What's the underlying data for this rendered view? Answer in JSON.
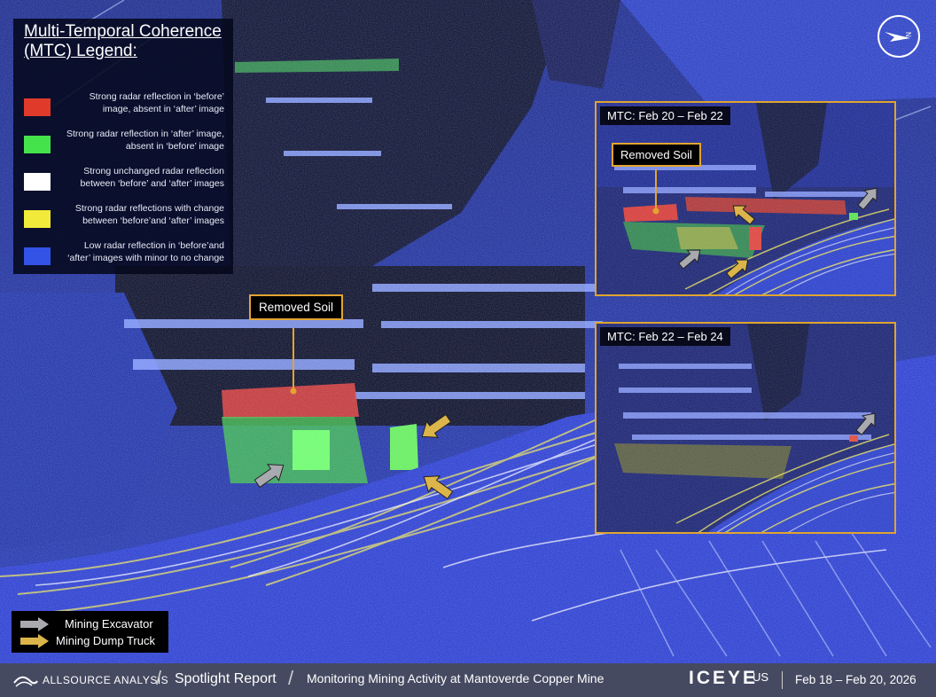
{
  "legend": {
    "title": "Multi-Temporal Coherence\n(MTC) Legend:",
    "items": [
      {
        "color": "#e03a2a",
        "text": "Strong radar reflection in ‘before’ image, absent in ‘after’ image"
      },
      {
        "color": "#45e34b",
        "text": "Strong radar reflection in ‘after’ image, absent in ‘before’ image"
      },
      {
        "color": "#ffffff",
        "text": "Strong unchanged radar reflection between ‘before’ and ‘after’ images"
      },
      {
        "color": "#f2ea3a",
        "text": "Strong radar reflections with change between ‘before’and ‘after’ images"
      },
      {
        "color": "#3352e6",
        "text": "Low radar reflection in ‘before’and ‘after’ images with minor to no change"
      }
    ]
  },
  "main": {
    "callout": "Removed Soil"
  },
  "insets": [
    {
      "title": "MTC: Feb 20 – Feb 22",
      "callout": "Removed Soil"
    },
    {
      "title": "MTC: Feb 22 – Feb 24"
    }
  ],
  "arrow_key": {
    "excavator": "Mining Excavator",
    "dump_truck": "Mining Dump Truck",
    "excavator_color": "#a9aab0",
    "truck_color": "#dcb54a"
  },
  "footer": {
    "brand": "ALLSOURCE ANALYSIS",
    "report": "Spotlight Report",
    "headline": "Monitoring Mining Activity at Mantoverde Copper Mine",
    "logo": "ICEYE",
    "logo_suffix": "US",
    "dates": "Feb 18 – Feb 20, 2026"
  },
  "icons": {
    "compass": "north-arrow-icon",
    "arrow": "arrow-icon"
  }
}
